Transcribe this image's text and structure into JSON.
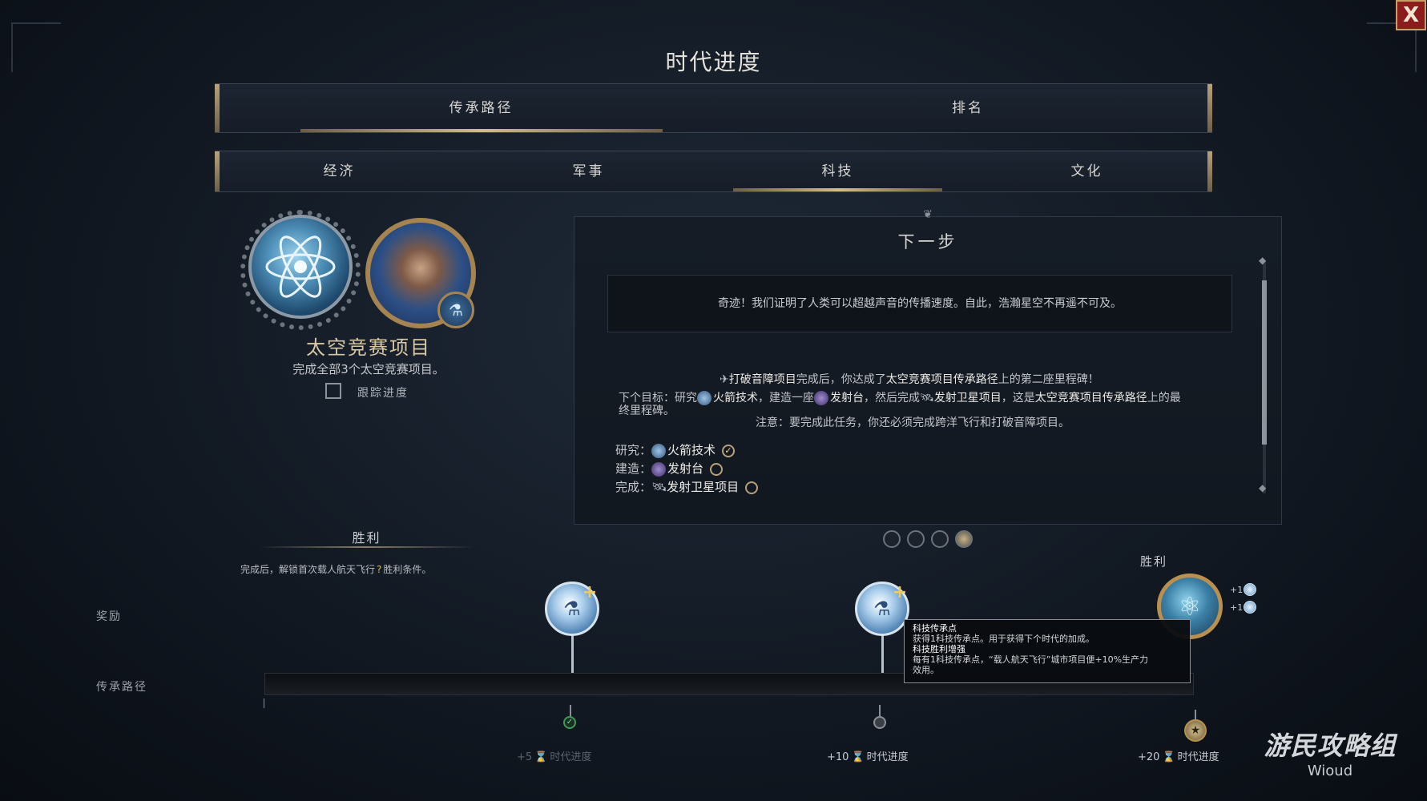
{
  "window": {
    "title": "时代进度",
    "close_label": "X"
  },
  "main_tabs": [
    {
      "label": "传承路径",
      "active": true
    },
    {
      "label": "排名",
      "active": false
    }
  ],
  "sub_tabs": [
    {
      "label": "经济",
      "active": false
    },
    {
      "label": "军事",
      "active": false
    },
    {
      "label": "科技",
      "active": true
    },
    {
      "label": "文化",
      "active": false
    }
  ],
  "project": {
    "title": "太空竞赛项目",
    "description": "完成全部3个太空竞赛项目。",
    "track_label": "跟踪进度",
    "track_checked": false
  },
  "next_step": {
    "title": "下一步",
    "quote": "奇迹！我们证明了人类可以超越声音的传播速度。自此，浩瀚星空不再遥不可及。",
    "line1_a": "打破音障项目",
    "line1_b": "完成后，你达成了",
    "line1_c": "太空竞赛项目传承路径",
    "line1_d": "上的第二座里程碑！",
    "line2_a": "下个目标：研究",
    "line2_b": "火箭技术",
    "line2_c": "，建造一座",
    "line2_d": "发射台",
    "line2_e": "，然后完成",
    "line2_f": "发射卫星项目",
    "line2_g": "，这是",
    "line2_h": "太空竞赛项目传承路径",
    "line2_i": "上的最",
    "line3": "终里程碑。",
    "note": "注意：要完成此任务，你还必须完成跨洋飞行和打破音障项目。",
    "requirements": [
      {
        "prefix": "研究：",
        "name": "火箭技术",
        "done": true
      },
      {
        "prefix": "建造：",
        "name": "发射台",
        "done": false
      },
      {
        "prefix": "完成：",
        "name": "发射卫星项目",
        "done": false
      }
    ],
    "page_count": 4,
    "current_page": 4
  },
  "victory_left": {
    "title": "胜利",
    "desc_a": "完成后，解锁首次载人航天飞行",
    "desc_b": "胜利条件。"
  },
  "track": {
    "rewards_label": "奖励",
    "path_label": "传承路径",
    "victory_label": "胜利",
    "milestones": [
      {
        "era_points": "+5",
        "era_label": "时代进度",
        "completed": true
      },
      {
        "era_points": "+10",
        "era_label": "时代进度",
        "completed": false
      },
      {
        "era_points": "+20",
        "era_label": "时代进度",
        "completed": false
      }
    ],
    "gem_bonus_1": "+1",
    "gem_bonus_2": "+1"
  },
  "tooltip": {
    "title1": "科技传承点",
    "body1": "获得1科技传承点。用于获得下个时代的加成。",
    "title2": "科技胜利增强",
    "body2a": "每有1科技传承点，“载人航天飞行”城市项目便+10%生产力",
    "body2b": "效用。"
  },
  "watermark": {
    "main": "游民攻略组",
    "sub": "Wioud"
  },
  "colors": {
    "accent_gold": "#d2bb8d",
    "close_red": "#8d1d1d",
    "completed_green": "#3f9a54"
  }
}
